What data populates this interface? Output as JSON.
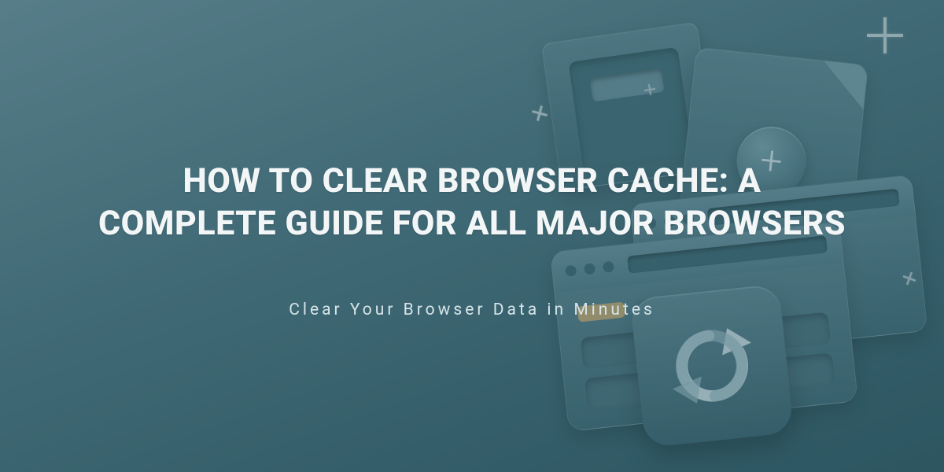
{
  "hero": {
    "title": "HOW TO CLEAR BROWSER CACHE: A COMPLETE GUIDE FOR ALL MAJOR BROWSERS",
    "subtitle": "Clear Your Browser Data in Minutes"
  }
}
